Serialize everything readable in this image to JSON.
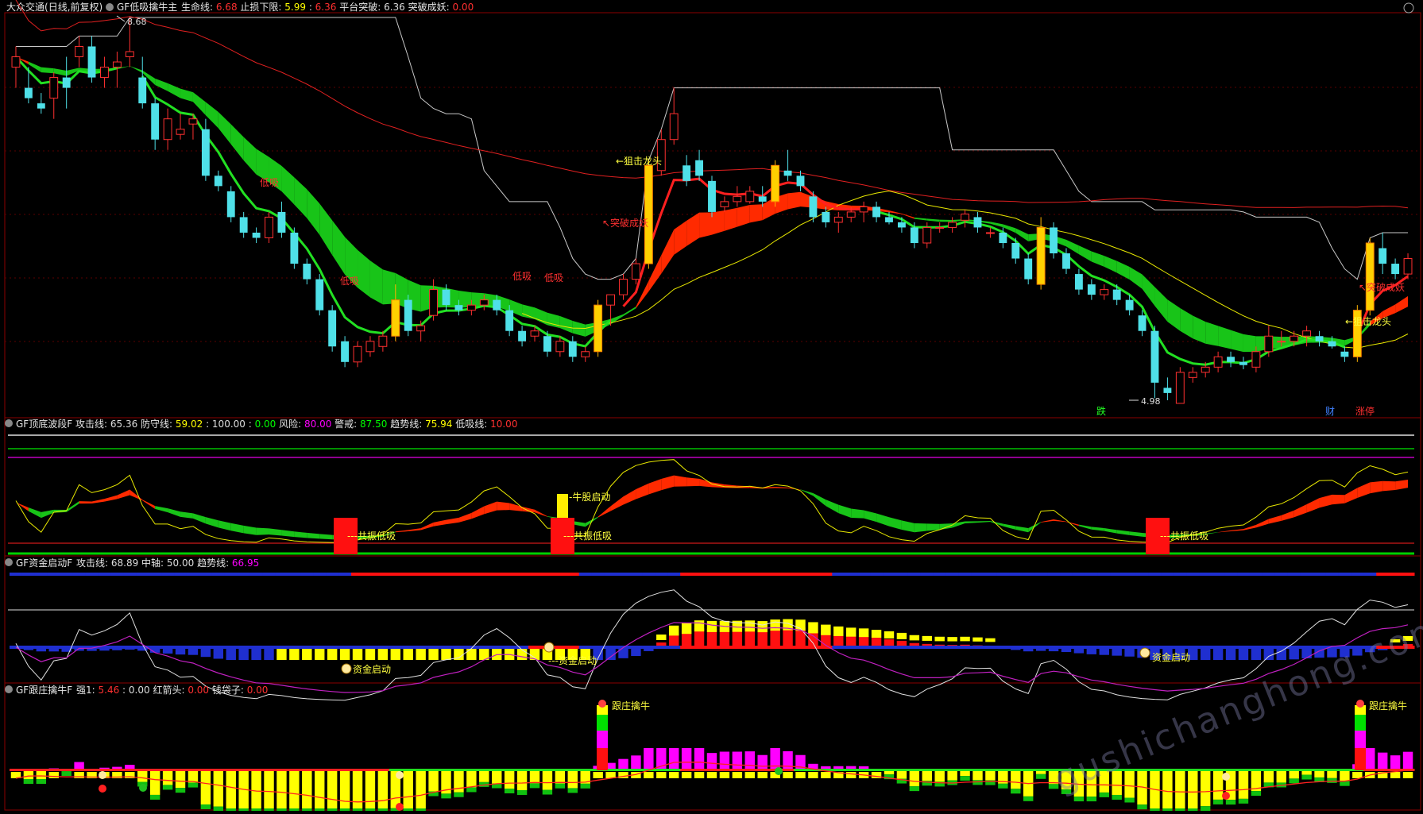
{
  "colors": {
    "bg": "#000000",
    "frame": "#8b0000",
    "candle_up": "#ff3030",
    "candle_down": "#4fe0e8",
    "candle_hl": "#ffb300",
    "ribbon_green": "#1ed01e",
    "ribbon_red": "#ff2a00",
    "line_yellow": "#e8e800",
    "line_white": "#c8c8c8",
    "line_red": "#e02020",
    "magenta": "#ff00ff",
    "yellow": "#ffff00",
    "blue": "#2233ff"
  },
  "panel1": {
    "stock_name": "大众交通",
    "period": "(日线,前复权)",
    "indicator": "GF低吸擒牛主",
    "fields": [
      {
        "label": "生命线: ",
        "value": "6.68",
        "color": "#ff3030"
      },
      {
        "label": "止损下限: ",
        "value": "5.99",
        "color": "#ffff00"
      },
      {
        "label": " : ",
        "value": "6.36",
        "color": "#ff3030"
      },
      {
        "label": "平台突破: ",
        "value": "6.36",
        "color": "#dddddd"
      },
      {
        "label": "突破成妖: ",
        "value": "0.00",
        "color": "#ff3030"
      }
    ],
    "high_label": "8.68",
    "low_label": "4.98",
    "annotations": {
      "dixi_1": "低吸",
      "dixi_2": "低吸",
      "dixi_3": "低吸",
      "dixi_4": "低吸",
      "juji_1": "←狙击龙头",
      "juji_2": "←狙击龙头",
      "tupo_1": "↖突破成妖",
      "tupo_2": "↖突破成妖"
    },
    "bottom_tags": {
      "die": "跌",
      "cai": "财",
      "zhangting": "涨停"
    }
  },
  "panel2": {
    "indicator": "GF顶底波段F",
    "fields": [
      {
        "label": "攻击线: ",
        "value": "65.36",
        "color": "#dddddd"
      },
      {
        "label": "防守线: ",
        "value": "59.02",
        "color": "#ffff00"
      },
      {
        "label": ": ",
        "value": "100.00",
        "color": "#dddddd"
      },
      {
        "label": ": ",
        "value": "0.00",
        "color": "#00ff00"
      },
      {
        "label": "风险: ",
        "value": "80.00",
        "color": "#ff00ff"
      },
      {
        "label": "警戒: ",
        "value": "87.50",
        "color": "#00ff00"
      },
      {
        "label": "趋势线: ",
        "value": "75.94",
        "color": "#ffff00"
      },
      {
        "label": "低吸线: ",
        "value": "10.00",
        "color": "#ff3030"
      }
    ],
    "labels": {
      "gongzhen_1": "共振低吸",
      "gongzhen_2": "共振低吸",
      "gongzhen_3": "共振低吸",
      "niugu": "牛股启动"
    }
  },
  "panel3": {
    "indicator": "GF资金启动F",
    "fields": [
      {
        "label": "攻击线: ",
        "value": "68.89",
        "color": "#dddddd"
      },
      {
        "label": "中轴: ",
        "value": "50.00",
        "color": "#dddddd"
      },
      {
        "label": "趋势线: ",
        "value": "66.95",
        "color": "#ff00ff"
      }
    ],
    "labels": {
      "zijin_1": "资金启动",
      "zijin_2": "资金启动",
      "zijin_3": "资金启动"
    }
  },
  "panel4": {
    "indicator": "GF跟庄擒牛F",
    "fields": [
      {
        "label": "强1: ",
        "value": "5.46",
        "color": "#ff3030"
      },
      {
        "label": ": ",
        "value": "0.00",
        "color": "#dddddd"
      },
      {
        "label": "红箭头: ",
        "value": "0.00",
        "color": "#ff3030"
      },
      {
        "label": "钱袋子: ",
        "value": "0.00",
        "color": "#ff3030"
      }
    ],
    "labels": {
      "genzhuang_1": "跟庄擒牛",
      "genzhuang_2": "跟庄擒牛"
    }
  },
  "watermark": "gushichanghong.com",
  "chart_data": {
    "type": "candlestick",
    "ylim_price": [
      4.98,
      8.68
    ],
    "candles": [
      [
        8.2,
        8.4,
        8.0,
        8.3
      ],
      [
        8.0,
        8.2,
        7.85,
        7.9
      ],
      [
        7.85,
        7.95,
        7.75,
        7.8
      ],
      [
        7.9,
        8.15,
        7.7,
        8.1
      ],
      [
        8.1,
        8.3,
        7.8,
        8.0
      ],
      [
        8.3,
        8.5,
        8.2,
        8.4
      ],
      [
        8.4,
        8.5,
        8.05,
        8.1
      ],
      [
        8.1,
        8.3,
        8.0,
        8.2
      ],
      [
        8.2,
        8.35,
        8.0,
        8.25
      ],
      [
        8.3,
        8.68,
        8.2,
        8.35
      ],
      [
        8.1,
        8.3,
        7.8,
        7.85
      ],
      [
        7.85,
        7.9,
        7.4,
        7.5
      ],
      [
        7.5,
        7.8,
        7.4,
        7.7
      ],
      [
        7.55,
        7.75,
        7.5,
        7.6
      ],
      [
        7.65,
        7.75,
        7.5,
        7.7
      ],
      [
        7.6,
        7.7,
        7.1,
        7.15
      ],
      [
        7.15,
        7.2,
        7.0,
        7.05
      ],
      [
        7.0,
        7.05,
        6.7,
        6.75
      ],
      [
        6.75,
        6.8,
        6.55,
        6.6
      ],
      [
        6.6,
        6.65,
        6.5,
        6.55
      ],
      [
        6.55,
        6.8,
        6.5,
        6.75
      ],
      [
        6.8,
        6.9,
        6.55,
        6.6
      ],
      [
        6.6,
        6.65,
        6.25,
        6.3
      ],
      [
        6.3,
        6.35,
        6.1,
        6.15
      ],
      [
        6.15,
        6.2,
        5.8,
        5.85
      ],
      [
        5.85,
        5.9,
        5.45,
        5.5
      ],
      [
        5.55,
        5.6,
        5.3,
        5.35
      ],
      [
        5.35,
        5.55,
        5.3,
        5.5
      ],
      [
        5.45,
        5.6,
        5.4,
        5.55
      ],
      [
        5.5,
        5.65,
        5.45,
        5.6
      ],
      [
        5.6,
        6.1,
        5.55,
        5.95
      ],
      [
        5.95,
        6.0,
        5.6,
        5.65
      ],
      [
        5.65,
        5.75,
        5.55,
        5.7
      ],
      [
        5.8,
        6.15,
        5.75,
        6.05
      ],
      [
        6.05,
        6.1,
        5.85,
        5.9
      ],
      [
        5.9,
        5.95,
        5.8,
        5.85
      ],
      [
        5.85,
        5.95,
        5.8,
        5.9
      ],
      [
        5.9,
        6.0,
        5.85,
        5.95
      ],
      [
        5.95,
        6.0,
        5.8,
        5.85
      ],
      [
        5.85,
        5.9,
        5.6,
        5.65
      ],
      [
        5.65,
        5.7,
        5.5,
        5.55
      ],
      [
        5.6,
        5.7,
        5.55,
        5.65
      ],
      [
        5.6,
        5.65,
        5.4,
        5.45
      ],
      [
        5.45,
        5.6,
        5.4,
        5.55
      ],
      [
        5.55,
        5.6,
        5.35,
        5.4
      ],
      [
        5.4,
        5.5,
        5.35,
        5.45
      ],
      [
        5.45,
        5.95,
        5.4,
        5.9
      ],
      [
        5.9,
        6.0,
        5.7,
        6.0
      ],
      [
        6.0,
        6.2,
        5.95,
        6.15
      ],
      [
        6.15,
        6.35,
        6.1,
        6.3
      ],
      [
        6.3,
        7.3,
        6.25,
        7.25
      ],
      [
        7.2,
        7.6,
        7.15,
        7.5
      ],
      [
        7.5,
        8.0,
        7.45,
        7.75
      ],
      [
        7.25,
        7.35,
        7.05,
        7.1
      ],
      [
        7.3,
        7.4,
        7.1,
        7.15
      ],
      [
        7.1,
        7.15,
        6.75,
        6.8
      ],
      [
        6.85,
        6.95,
        6.8,
        6.9
      ],
      [
        6.9,
        7.05,
        6.85,
        6.95
      ],
      [
        6.9,
        7.05,
        6.88,
        7.0
      ],
      [
        6.95,
        7.05,
        6.85,
        6.9
      ],
      [
        6.9,
        7.3,
        6.85,
        7.25
      ],
      [
        7.2,
        7.4,
        7.1,
        7.15
      ],
      [
        7.15,
        7.2,
        7.0,
        7.05
      ],
      [
        6.95,
        7.0,
        6.7,
        6.75
      ],
      [
        6.8,
        6.85,
        6.65,
        6.7
      ],
      [
        6.7,
        6.8,
        6.6,
        6.75
      ],
      [
        6.75,
        6.85,
        6.7,
        6.8
      ],
      [
        6.8,
        6.9,
        6.7,
        6.85
      ],
      [
        6.85,
        6.9,
        6.7,
        6.75
      ],
      [
        6.75,
        6.8,
        6.68,
        6.7
      ],
      [
        6.7,
        6.75,
        6.6,
        6.65
      ],
      [
        6.65,
        6.7,
        6.45,
        6.5
      ],
      [
        6.5,
        6.7,
        6.45,
        6.65
      ],
      [
        6.65,
        6.7,
        6.6,
        6.65
      ],
      [
        6.65,
        6.75,
        6.6,
        6.7
      ],
      [
        6.72,
        6.82,
        6.65,
        6.78
      ],
      [
        6.75,
        6.8,
        6.6,
        6.65
      ],
      [
        6.6,
        6.65,
        6.55,
        6.6
      ],
      [
        6.6,
        6.65,
        6.45,
        6.5
      ],
      [
        6.5,
        6.55,
        6.3,
        6.35
      ],
      [
        6.35,
        6.4,
        6.1,
        6.15
      ],
      [
        6.1,
        6.75,
        6.05,
        6.65
      ],
      [
        6.65,
        6.7,
        6.35,
        6.4
      ],
      [
        6.4,
        6.45,
        6.2,
        6.25
      ],
      [
        6.2,
        6.25,
        6.0,
        6.05
      ],
      [
        6.1,
        6.15,
        5.95,
        6.0
      ],
      [
        6.0,
        6.1,
        5.95,
        6.05
      ],
      [
        6.05,
        6.1,
        5.9,
        5.95
      ],
      [
        5.95,
        6.0,
        5.8,
        5.85
      ],
      [
        5.8,
        5.85,
        5.6,
        5.65
      ],
      [
        5.65,
        5.7,
        5.0,
        5.15
      ],
      [
        5.1,
        5.2,
        4.98,
        5.05
      ],
      [
        4.95,
        5.3,
        4.95,
        5.25
      ],
      [
        5.2,
        5.3,
        5.15,
        5.25
      ],
      [
        5.25,
        5.35,
        5.2,
        5.3
      ],
      [
        5.3,
        5.45,
        5.25,
        5.4
      ],
      [
        5.4,
        5.45,
        5.3,
        5.35
      ],
      [
        5.35,
        5.4,
        5.28,
        5.32
      ],
      [
        5.3,
        5.5,
        5.25,
        5.45
      ],
      [
        5.45,
        5.7,
        5.4,
        5.6
      ],
      [
        5.55,
        5.65,
        5.5,
        5.55
      ],
      [
        5.55,
        5.65,
        5.5,
        5.6
      ],
      [
        5.6,
        5.7,
        5.5,
        5.65
      ],
      [
        5.6,
        5.65,
        5.5,
        5.55
      ],
      [
        5.55,
        5.6,
        5.48,
        5.5
      ],
      [
        5.45,
        5.5,
        5.35,
        5.4
      ],
      [
        5.4,
        5.9,
        5.35,
        5.85
      ],
      [
        5.85,
        6.55,
        5.8,
        6.5
      ],
      [
        6.45,
        6.6,
        6.2,
        6.3
      ],
      [
        6.3,
        6.35,
        6.15,
        6.2
      ],
      [
        6.2,
        6.4,
        6.15,
        6.35
      ]
    ]
  }
}
